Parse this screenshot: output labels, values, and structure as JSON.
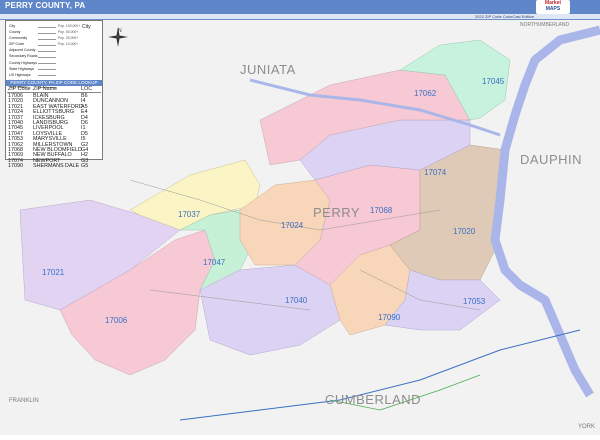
{
  "title": "PERRY COUNTY, PA",
  "subtitle": "2022 ZIP Code ColorCast Edition",
  "logo": {
    "line1": "Market",
    "line2": "MAPS"
  },
  "compass_label": "N",
  "legend": {
    "rows": [
      {
        "label": "City",
        "desc": "Pop. 100,000+"
      },
      {
        "label": "County",
        "desc": "Pop. 50,000+"
      },
      {
        "label": "Community",
        "desc": "Pop. 25,000+"
      },
      {
        "label": "ZIP Code",
        "desc": "Pop. 10,000+"
      },
      {
        "label": "Adjacent County",
        "desc": ""
      },
      {
        "label": "Secondary Roads",
        "desc": ""
      },
      {
        "label": "County Highways",
        "desc": ""
      },
      {
        "label": "State Highways",
        "desc": ""
      },
      {
        "label": "US Highways",
        "desc": ""
      },
      {
        "label": "Interstate Highways",
        "desc": ""
      },
      {
        "label": "Toll Roads",
        "desc": ""
      }
    ],
    "city_key": "City"
  },
  "zip_table": {
    "heading": "PERRY COUNTY, PA ZIP CODE LOOKUP",
    "columns": [
      "ZIP Code",
      "ZIP Name",
      "LOC"
    ],
    "rows": [
      [
        "17006",
        "BLAIN",
        "B6"
      ],
      [
        "17020",
        "DUNCANNON",
        "I4"
      ],
      [
        "17021",
        "EAST WATERFORD",
        "A5"
      ],
      [
        "17024",
        "ELLIOTTSBURG",
        "E4"
      ],
      [
        "17037",
        "ICKESBURG",
        "D4"
      ],
      [
        "17040",
        "LANDISBURG",
        "D6"
      ],
      [
        "17045",
        "LIVERPOOL",
        "I1"
      ],
      [
        "17047",
        "LOYSVILLE",
        "D5"
      ],
      [
        "17053",
        "MARYSVILLE",
        "I5"
      ],
      [
        "17062",
        "MILLERSTOWN",
        "G2"
      ],
      [
        "17068",
        "NEW BLOOMFIELD",
        "G4"
      ],
      [
        "17069",
        "NEW BUFFALO",
        "H2"
      ],
      [
        "17074",
        "NEWPORT",
        "G3"
      ],
      [
        "17090",
        "SHERMANS DALE",
        "G5"
      ]
    ]
  },
  "counties": {
    "perry": "PERRY",
    "juniata": "JUNIATA",
    "dauphin": "DAUPHIN",
    "cumberland": "CUMBERLAND",
    "franklin": "FRANKLIN",
    "northumberland": "NORTHUMBERLAND",
    "york": "YORK"
  },
  "zip_labels": {
    "z17045": "17045",
    "z17062": "17062",
    "z17074": "17074",
    "z17037": "17037",
    "z17024": "17024",
    "z17068": "17068",
    "z17020": "17020",
    "z17047": "17047",
    "z17021": "17021",
    "z17040": "17040",
    "z17053": "17053",
    "z17090": "17090",
    "z17006": "17006"
  },
  "colors": {
    "title_bar": "#5f86c8",
    "zip_label": "#3a70c6",
    "river": "#aab6ea",
    "z17045": "#c7f2dd",
    "z17062": "#f6c9d4",
    "z17074": "#dcd2f3",
    "z17037": "#fbf5c6",
    "z17024": "#f7d6b9",
    "z17068": "#f6c9d4",
    "z17020": "#dfcab7",
    "z17047": "#c6f1d6",
    "z17021": "#e3d3f2",
    "z17040": "#dcd2f3",
    "z17053": "#dcd2f3",
    "z17090": "#f7d6b9",
    "z17006": "#f6c9d4"
  }
}
